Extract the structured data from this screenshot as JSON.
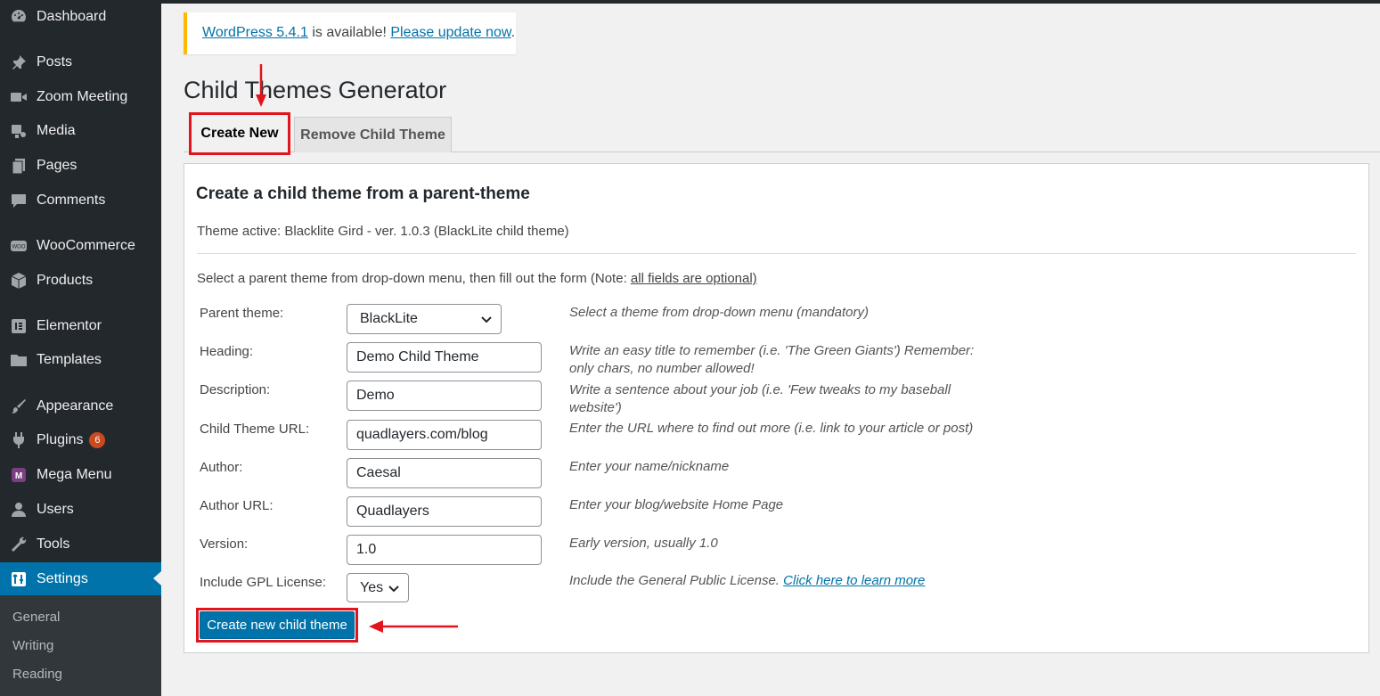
{
  "sidebar": {
    "items": [
      {
        "label": "Dashboard",
        "icon": "dashboard-icon"
      },
      {
        "label": "Posts",
        "icon": "pin-icon"
      },
      {
        "label": "Zoom Meeting",
        "icon": "video-icon"
      },
      {
        "label": "Media",
        "icon": "media-icon"
      },
      {
        "label": "Pages",
        "icon": "pages-icon"
      },
      {
        "label": "Comments",
        "icon": "comment-icon"
      },
      {
        "label": "WooCommerce",
        "icon": "woo-icon"
      },
      {
        "label": "Products",
        "icon": "box-icon"
      },
      {
        "label": "Elementor",
        "icon": "elementor-icon"
      },
      {
        "label": "Templates",
        "icon": "folder-icon"
      },
      {
        "label": "Appearance",
        "icon": "brush-icon"
      },
      {
        "label": "Plugins",
        "icon": "plug-icon",
        "badge": "6"
      },
      {
        "label": "Mega Menu",
        "icon": "mega-menu-icon"
      },
      {
        "label": "Users",
        "icon": "user-icon"
      },
      {
        "label": "Tools",
        "icon": "wrench-icon"
      },
      {
        "label": "Settings",
        "icon": "settings-icon"
      }
    ],
    "submenu": [
      "General",
      "Writing",
      "Reading"
    ]
  },
  "notice": {
    "version_link": "WordPress 5.4.1",
    "middle": " is available! ",
    "update_link": "Please update now",
    "end": "."
  },
  "page": {
    "title": "Child Themes Generator",
    "tabs": [
      "Create New",
      "Remove Child Theme"
    ]
  },
  "panel": {
    "heading": "Create a child theme from a parent-theme",
    "theme_active": "Theme active: Blacklite Gird - ver. 1.0.3 (BlackLite child theme)",
    "instructions": "Select a parent theme from drop-down menu, then fill out the form (Note: ",
    "instructions_link": "all fields are optional)",
    "rows": [
      {
        "label": "Parent theme:",
        "value": "BlackLite",
        "help": "Select a theme from drop-down menu (mandatory)"
      },
      {
        "label": "Heading:",
        "value": "Demo Child Theme",
        "help": "Write an easy title to remember (i.e. 'The Green Giants')    Remember:",
        "help2": "only chars, no number allowed!"
      },
      {
        "label": "Description:",
        "value": "Demo",
        "help": "Write a sentence about your job (i.e. 'Few tweaks to my baseball",
        "help2": "website')"
      },
      {
        "label": "Child Theme URL:",
        "value": "quadlayers.com/blog",
        "help": "Enter the URL where to find out more (i.e. link to your article or post)"
      },
      {
        "label": "Author:",
        "value": "Caesal",
        "help": "Enter your name/nickname"
      },
      {
        "label": "Author URL:",
        "value": "Quadlayers",
        "help": "Enter your blog/website Home Page"
      },
      {
        "label": "Version:",
        "value": "1.0",
        "help": "Early version, usually 1.0"
      },
      {
        "label": "Include GPL License:",
        "value": "Yes",
        "help": "Include the General Public License. ",
        "help_link": "Click here to learn more"
      }
    ],
    "submit": "Create new child theme"
  },
  "colors": {
    "sidebar_bg": "#23282d",
    "accent": "#0073aa",
    "annotation_red": "#e0151d",
    "notice_border": "#ffb900"
  }
}
